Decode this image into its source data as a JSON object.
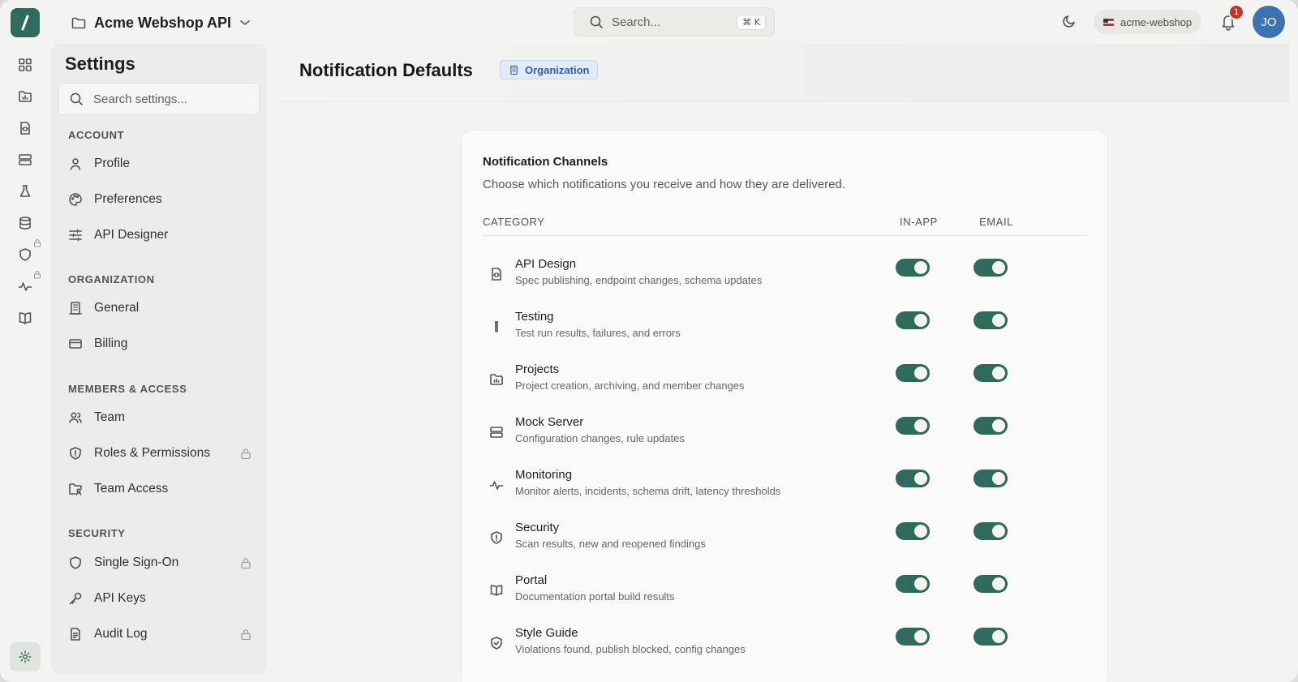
{
  "app": {
    "project_name": "Acme Webshop API",
    "workspace": "acme-webshop",
    "notification_count": "1",
    "avatar_initials": "JO"
  },
  "search": {
    "placeholder": "Search...",
    "shortcut": "⌘ K"
  },
  "settings": {
    "title": "Settings",
    "search_placeholder": "Search settings...",
    "sections": [
      {
        "label": "ACCOUNT",
        "items": [
          {
            "label": "Profile",
            "icon": "user-icon",
            "locked": false
          },
          {
            "label": "Preferences",
            "icon": "palette-icon",
            "locked": false
          },
          {
            "label": "API Designer",
            "icon": "sliders-icon",
            "locked": false
          }
        ]
      },
      {
        "label": "ORGANIZATION",
        "items": [
          {
            "label": "General",
            "icon": "building-icon",
            "locked": false
          },
          {
            "label": "Billing",
            "icon": "credit-card-icon",
            "locked": false
          }
        ]
      },
      {
        "label": "MEMBERS & ACCESS",
        "items": [
          {
            "label": "Team",
            "icon": "users-icon",
            "locked": false
          },
          {
            "label": "Roles & Permissions",
            "icon": "shield-icon",
            "locked": true
          },
          {
            "label": "Team Access",
            "icon": "folder-users-icon",
            "locked": false
          }
        ]
      },
      {
        "label": "SECURITY",
        "items": [
          {
            "label": "Single Sign-On",
            "icon": "shield-icon",
            "locked": true
          },
          {
            "label": "API Keys",
            "icon": "key-icon",
            "locked": false
          },
          {
            "label": "Audit Log",
            "icon": "file-text-icon",
            "locked": true
          }
        ]
      }
    ]
  },
  "main": {
    "title": "Notification Defaults",
    "scope_badge": "Organization",
    "card": {
      "title": "Notification Channels",
      "subtitle": "Choose which notifications you receive and how they are delivered.",
      "columns": [
        "CATEGORY",
        "IN-APP",
        "EMAIL"
      ],
      "rows": [
        {
          "title": "API Design",
          "desc": "Spec publishing, endpoint changes, schema updates",
          "icon": "file-code-icon",
          "in_app": true,
          "email": true
        },
        {
          "title": "Testing",
          "desc": "Test run results, failures, and errors",
          "icon": "test-tube-icon",
          "in_app": true,
          "email": true
        },
        {
          "title": "Projects",
          "desc": "Project creation, archiving, and member changes",
          "icon": "folder-chart-icon",
          "in_app": true,
          "email": true
        },
        {
          "title": "Mock Server",
          "desc": "Configuration changes, rule updates",
          "icon": "server-icon",
          "in_app": true,
          "email": true
        },
        {
          "title": "Monitoring",
          "desc": "Monitor alerts, incidents, schema drift, latency thresholds",
          "icon": "activity-icon",
          "in_app": true,
          "email": true
        },
        {
          "title": "Security",
          "desc": "Scan results, new and reopened findings",
          "icon": "shield-alert-icon",
          "in_app": true,
          "email": true
        },
        {
          "title": "Portal",
          "desc": "Documentation portal build results",
          "icon": "book-open-icon",
          "in_app": true,
          "email": true
        },
        {
          "title": "Style Guide",
          "desc": "Violations found, publish blocked, config changes",
          "icon": "shield-check-icon",
          "in_app": true,
          "email": true
        }
      ]
    }
  }
}
